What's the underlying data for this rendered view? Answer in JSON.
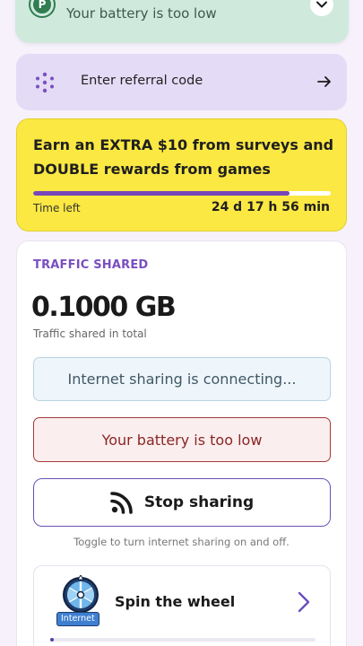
{
  "status_card": {
    "app_icon_letter": "P",
    "message": "Your battery is too low"
  },
  "referral": {
    "label": "Enter referral code"
  },
  "promo": {
    "title": "Earn an EXTRA $10 from surveys and DOUBLE rewards from games",
    "progress_percent": 86,
    "time_left_label": "Time left",
    "time_left_value": "24 d 17 h 56 min"
  },
  "traffic": {
    "section_label": "TRAFFIC SHARED",
    "value": "0.1000 GB",
    "sub_label": "Traffic shared in total",
    "connecting_message": "Internet sharing is connecting...",
    "battery_message": "Your battery is too low",
    "stop_button_label": "Stop sharing",
    "toggle_hint": "Toggle to turn internet sharing on and off."
  },
  "spin": {
    "badge": "Internet",
    "label": "Spin the wheel",
    "progress_percent": 1
  },
  "colors": {
    "accent": "#7a4fc0",
    "promo_bg": "#fbe843",
    "status_bg": "#cfeadd",
    "referral_bg": "#e4dbf6",
    "error": "#a63a3a"
  }
}
